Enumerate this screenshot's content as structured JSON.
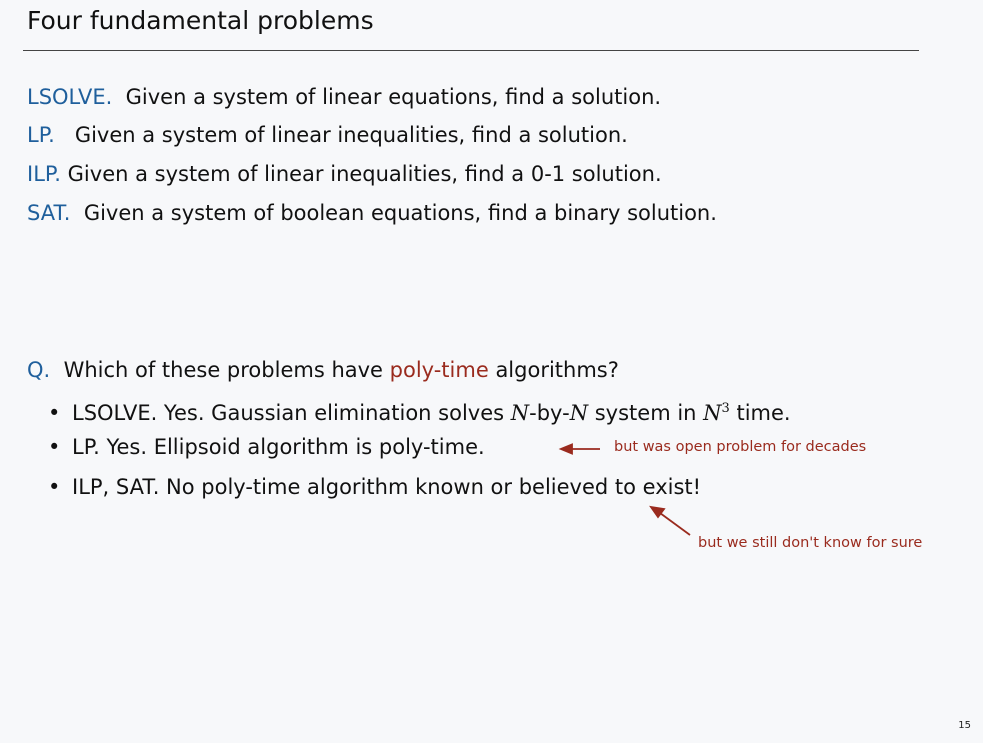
{
  "title": "Four fundamental problems",
  "problems": [
    {
      "name": "LSOLVE.",
      "text": "Given a system of linear equations, find a solution."
    },
    {
      "name": "LP.",
      "text": "Given a system of linear inequalities, find a solution."
    },
    {
      "name": "ILP.",
      "text": "Given a system of linear inequalities, find a 0-1 solution."
    },
    {
      "name": "SAT.",
      "text": "Given a system of boolean equations, find a binary solution."
    }
  ],
  "question": {
    "label": "Q.",
    "before": "Which of these problems have",
    "highlight": "poly-time",
    "after": "algorithms?"
  },
  "answers": [
    {
      "bullet": "•",
      "parts": [
        "LSOLVE.  Yes. Gaussian elimination solves ",
        "N",
        "-by-",
        "N",
        " system in ",
        "N",
        "3",
        " time."
      ]
    },
    {
      "bullet": "•",
      "text": "LP.  Yes. Ellipsoid algorithm is poly-time."
    },
    {
      "bullet": "•",
      "text": "ILP, SAT.  No poly-time algorithm known or believed to exist!"
    }
  ],
  "annotations": [
    "but was open problem for decades",
    "but we still don't know for sure"
  ],
  "colors": {
    "keyword": "#1f5f9c",
    "accent": "#9a2b1e",
    "background": "#f7f8fa"
  },
  "page_number": "15"
}
